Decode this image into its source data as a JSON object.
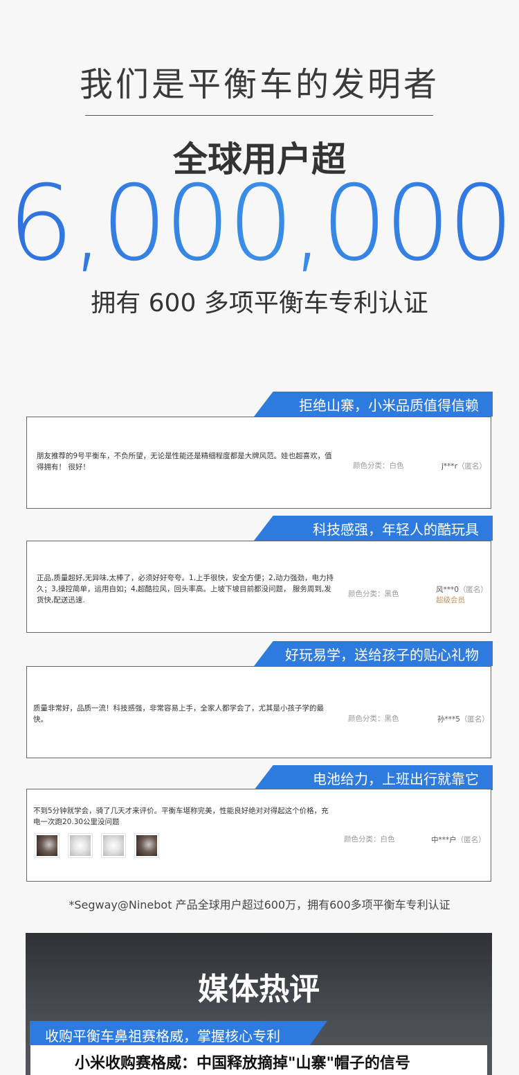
{
  "hero": {
    "title": "我们是平衡车的发明者",
    "subtitle": "全球用户超",
    "user_count": "6,000,000",
    "patent_text": "拥有 600 多项平衡车专利认证"
  },
  "reviews": [
    {
      "banner": "拒绝山寨，小米品质值得信赖",
      "text": "朋友推荐的9号平衡车，不负所望，无论是性能还是精细程度都是大牌风范。娃也超喜欢，值得拥有！ 很好！",
      "color": "颜色分类：白色",
      "user": "j***r",
      "anon": "（匿名）"
    },
    {
      "banner": "科技感强，年轻人的酷玩具",
      "text": "正品,质量超好,无异味,太棒了，必须好好夸夸。1,上手很快，安全方便；2,动力强劲，电力持久；3,操控简单，运用自如；4,超酷拉风，回头率高。上坡下坡目前都没问题， 服务周到,发货快,配送迅速.",
      "color": "颜色分类：黑色",
      "user": "风***0",
      "anon": "（匿名）",
      "vip": "超级会员"
    },
    {
      "banner": "好玩易学，送给孩子的贴心礼物",
      "text": "质量非常好，品质一流！科技感强，非常容易上手，全家人都学会了，尤其是小孩子学的最快。",
      "color": "颜色分类：黑色",
      "user": "孙***5",
      "anon": "（匿名）"
    },
    {
      "banner": "电池给力，上班出行就靠它",
      "text": "不到5分钟就学会，骑了几天才来评价。平衡车堪称完美，性能良好绝对对得起这个价格，充电一次跑20.30公里没问题",
      "color": "颜色分类：白色",
      "user": "中***户",
      "anon": "（匿名）"
    }
  ],
  "footnote": "*Segway@Ninebot 产品全球用户超过600万，拥有600多项平衡车专利认证",
  "media": {
    "title": "媒体热评",
    "banner": "收购平衡车鼻祖赛格威，掌握核心专利",
    "headline": "小米收购赛格威：中国释放摘掉\"山寨\"帽子的信号"
  },
  "colors": {
    "accent": "#2e7be0",
    "number_gradient_start": "#2e6fe0",
    "number_gradient_end": "#3a8fe6",
    "vip": "#c0935a"
  }
}
